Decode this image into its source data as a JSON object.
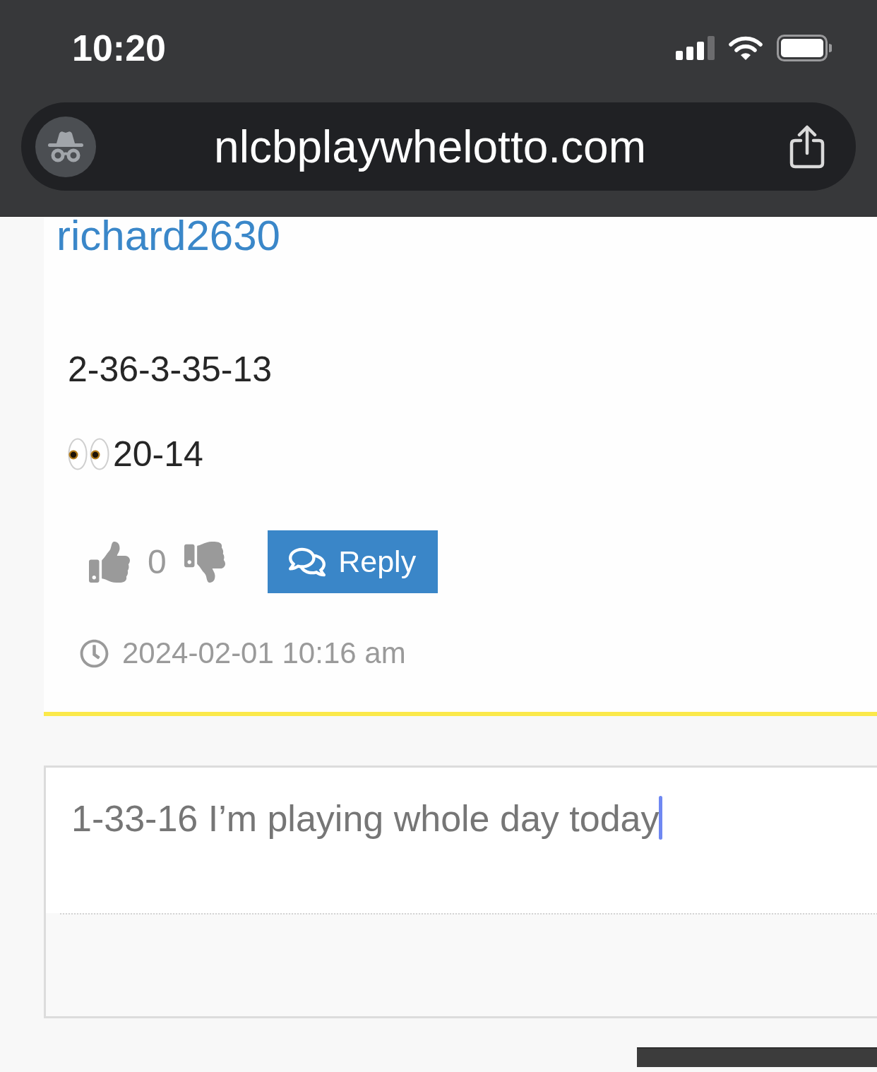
{
  "status_bar": {
    "time": "10:20"
  },
  "address_bar": {
    "url": "nlcbplaywhelotto.com"
  },
  "comment": {
    "author": "richard2630",
    "lines": [
      {
        "kind": "text",
        "text": "2-36-3-35-13"
      },
      {
        "kind": "emoji",
        "text": "20-14"
      }
    ],
    "votes": "0",
    "reply_button": "Reply",
    "timestamp": "2024-02-01 10:16 am"
  },
  "reply_form": {
    "value": "1-33-16 I’m playing whole day today",
    "focused": true
  }
}
